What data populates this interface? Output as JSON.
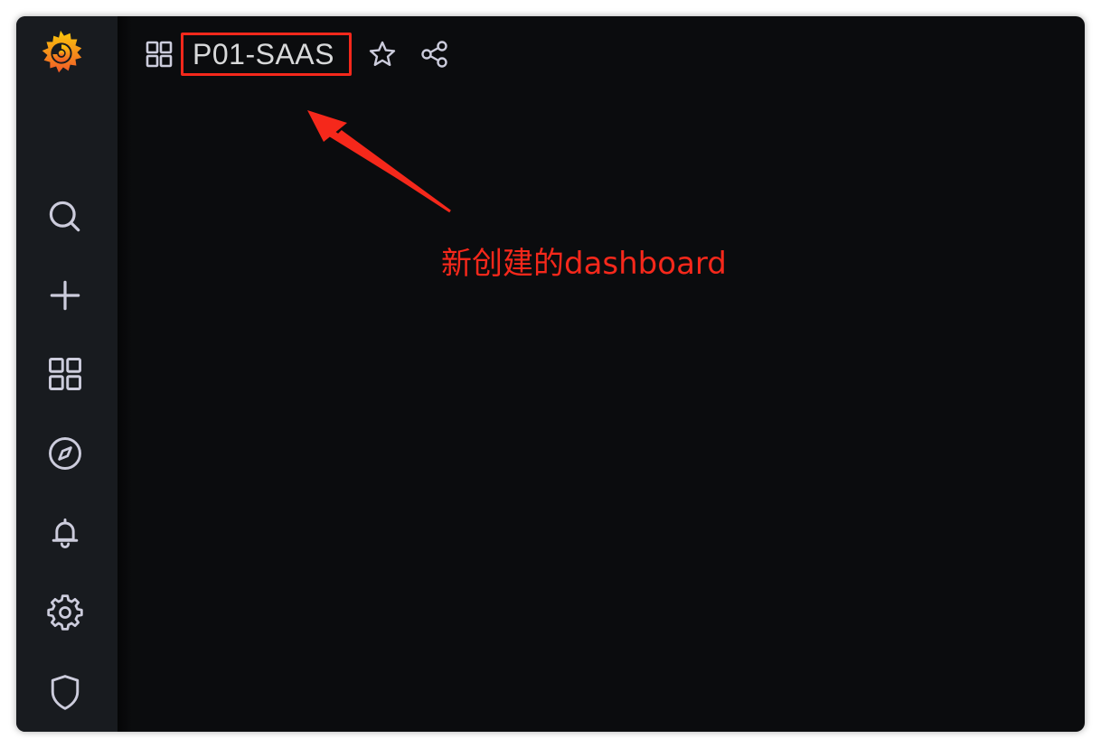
{
  "dashboard": {
    "title": "P01-SAAS"
  },
  "annotation": {
    "text": "新创建的dashboard",
    "color": "#f5281b"
  },
  "sidebar": {
    "items": [
      {
        "icon": "search-icon"
      },
      {
        "icon": "plus-icon"
      },
      {
        "icon": "dashboards-icon"
      },
      {
        "icon": "compass-icon"
      },
      {
        "icon": "bell-icon"
      },
      {
        "icon": "gear-icon"
      },
      {
        "icon": "shield-icon"
      }
    ]
  },
  "colors": {
    "background": "#0b0c0e",
    "sidebar": "#181b1f",
    "icon": "#ccccdc",
    "highlight": "#f5281b",
    "logo_orange": "#f58220",
    "logo_yellow": "#fbca0a"
  }
}
